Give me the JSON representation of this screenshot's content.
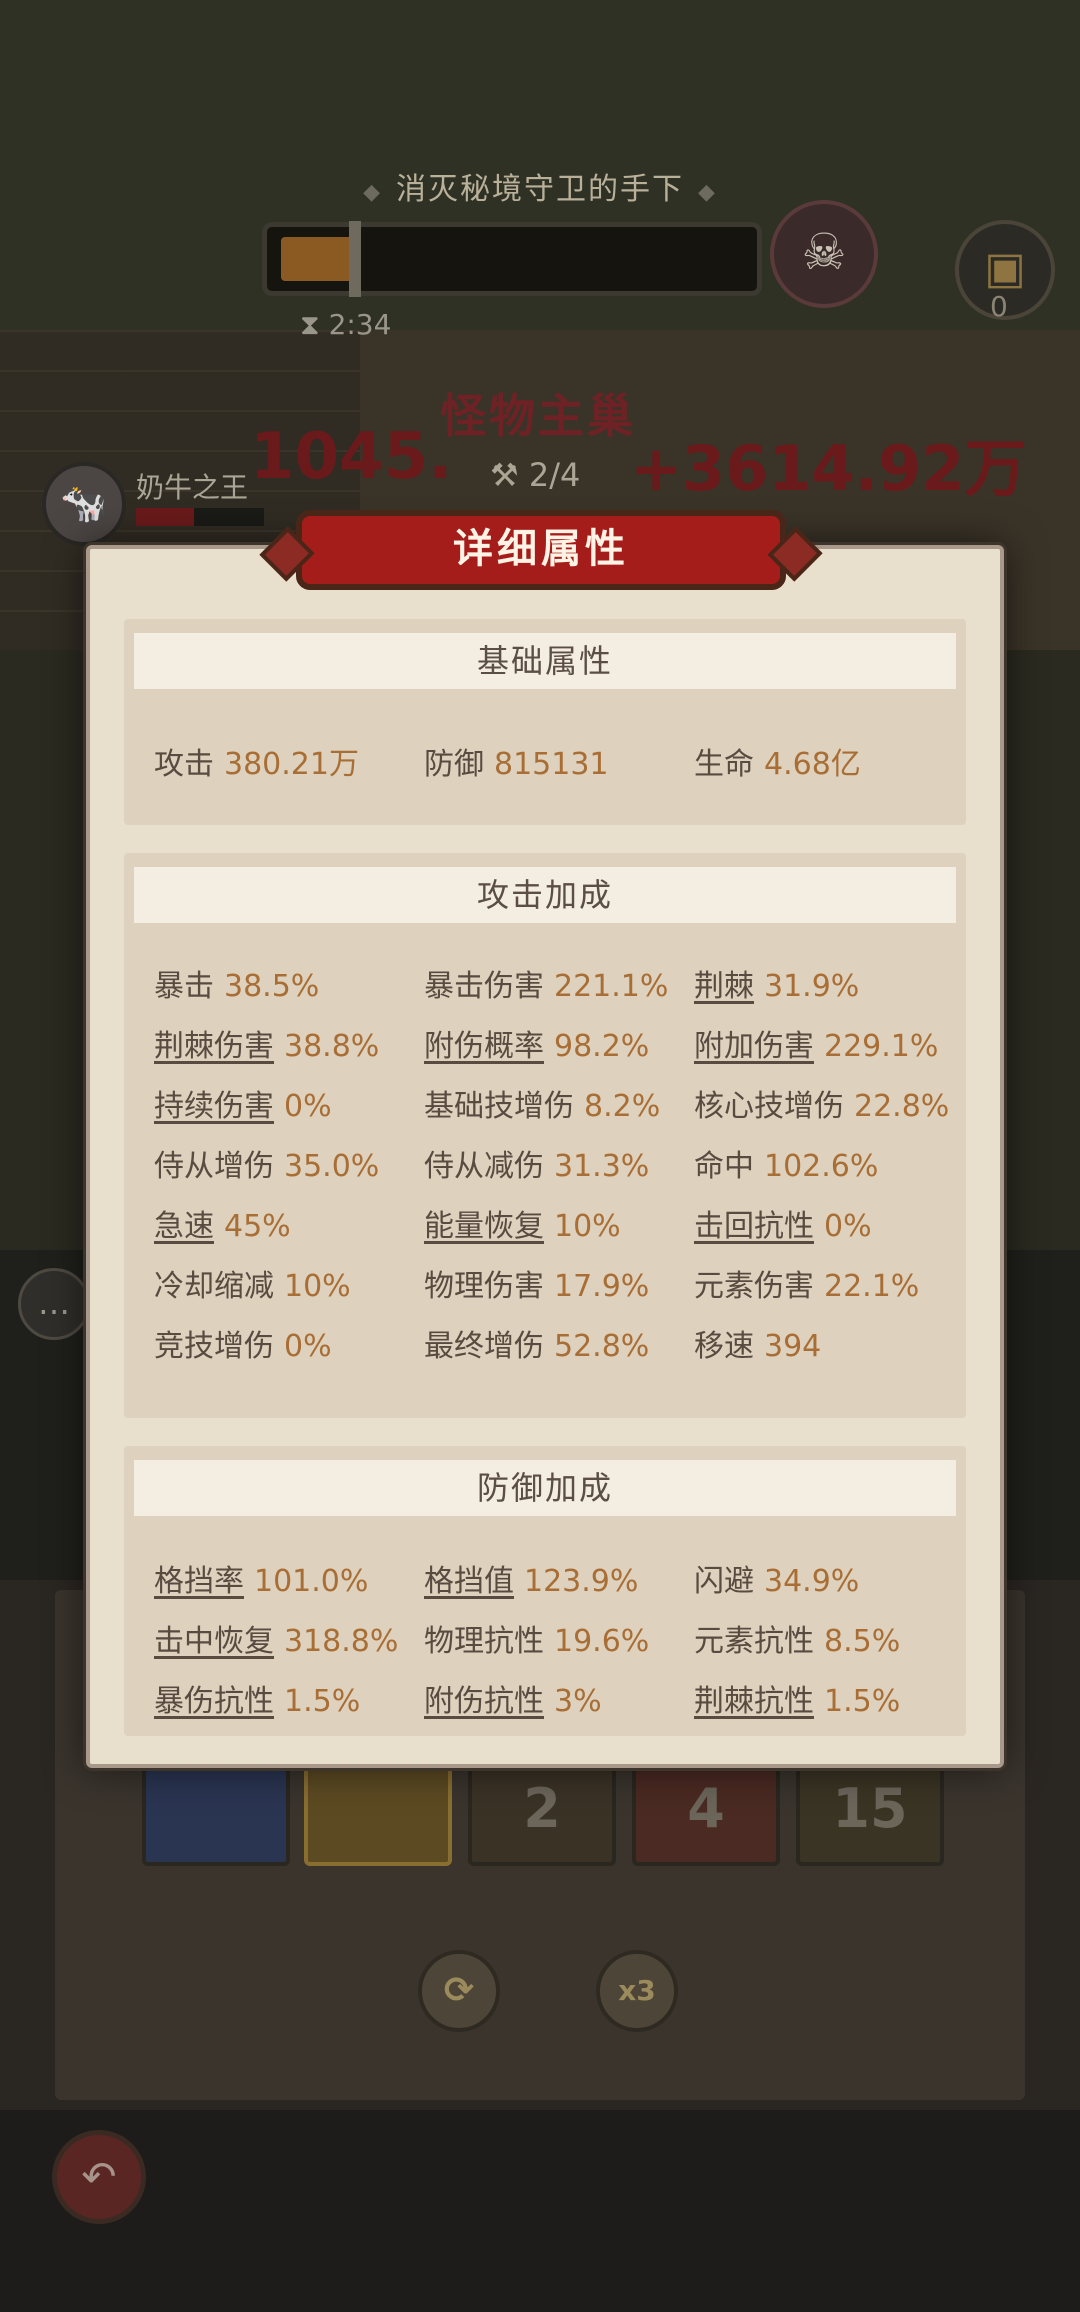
{
  "game": {
    "objective": "消灭秘境守卫的手下",
    "timer": "2:34",
    "chest_count": "0",
    "nest_title": "怪物主巢",
    "damage_left": "1045.",
    "damage_right": "+3614.92万",
    "wave": "2/4",
    "player_name": "奶牛之王",
    "progress_fraction": 0.25,
    "player_hp_fraction": 0.45,
    "skill_slots": [
      "",
      "",
      "2",
      "4",
      "15"
    ],
    "multiplier_button": "x3"
  },
  "dialog": {
    "title": "详细属性",
    "sections": [
      {
        "title": "基础属性",
        "stats": [
          {
            "label": "攻击",
            "value": "380.21万",
            "link": false
          },
          {
            "label": "防御",
            "value": "815131",
            "link": false
          },
          {
            "label": "生命",
            "value": "4.68亿",
            "link": false
          }
        ]
      },
      {
        "title": "攻击加成",
        "stats": [
          {
            "label": "暴击",
            "value": "38.5%",
            "link": false
          },
          {
            "label": "暴击伤害",
            "value": "221.1%",
            "link": false
          },
          {
            "label": "荆棘",
            "value": "31.9%",
            "link": true
          },
          {
            "label": "荆棘伤害",
            "value": "38.8%",
            "link": true
          },
          {
            "label": "附伤概率",
            "value": "98.2%",
            "link": true
          },
          {
            "label": "附加伤害",
            "value": "229.1%",
            "link": true
          },
          {
            "label": "持续伤害",
            "value": "0%",
            "link": true
          },
          {
            "label": "基础技增伤",
            "value": "8.2%",
            "link": false
          },
          {
            "label": "核心技增伤",
            "value": "22.8%",
            "link": false
          },
          {
            "label": "侍从增伤",
            "value": "35.0%",
            "link": false
          },
          {
            "label": "侍从减伤",
            "value": "31.3%",
            "link": false
          },
          {
            "label": "命中",
            "value": "102.6%",
            "link": false
          },
          {
            "label": "急速",
            "value": "45%",
            "link": true
          },
          {
            "label": "能量恢复",
            "value": "10%",
            "link": true
          },
          {
            "label": "击回抗性",
            "value": "0%",
            "link": true
          },
          {
            "label": "冷却缩减",
            "value": "10%",
            "link": false
          },
          {
            "label": "物理伤害",
            "value": "17.9%",
            "link": false
          },
          {
            "label": "元素伤害",
            "value": "22.1%",
            "link": false
          },
          {
            "label": "竞技增伤",
            "value": "0%",
            "link": false
          },
          {
            "label": "最终增伤",
            "value": "52.8%",
            "link": false
          },
          {
            "label": "移速",
            "value": "394",
            "link": false
          }
        ]
      },
      {
        "title": "防御加成",
        "stats": [
          {
            "label": "格挡率",
            "value": "101.0%",
            "link": true
          },
          {
            "label": "格挡值",
            "value": "123.9%",
            "link": true
          },
          {
            "label": "闪避",
            "value": "34.9%",
            "link": false
          },
          {
            "label": "击中恢复",
            "value": "318.8%",
            "link": true
          },
          {
            "label": "物理抗性",
            "value": "19.6%",
            "link": false
          },
          {
            "label": "元素抗性",
            "value": "8.5%",
            "link": false
          },
          {
            "label": "暴伤抗性",
            "value": "1.5%",
            "link": true
          },
          {
            "label": "附伤抗性",
            "value": "3%",
            "link": true
          },
          {
            "label": "荆棘抗性",
            "value": "1.5%",
            "link": true
          }
        ]
      }
    ]
  },
  "colors": {
    "label": "#5a4b41",
    "value": "#a86e35",
    "title_band": "#a51d1b",
    "parchment": "#e9dfcd"
  },
  "icons": [
    "hourglass-icon",
    "boss-skull-icon",
    "treasure-chest-icon",
    "chat-icon",
    "refresh-icon",
    "back-arrow-icon"
  ]
}
